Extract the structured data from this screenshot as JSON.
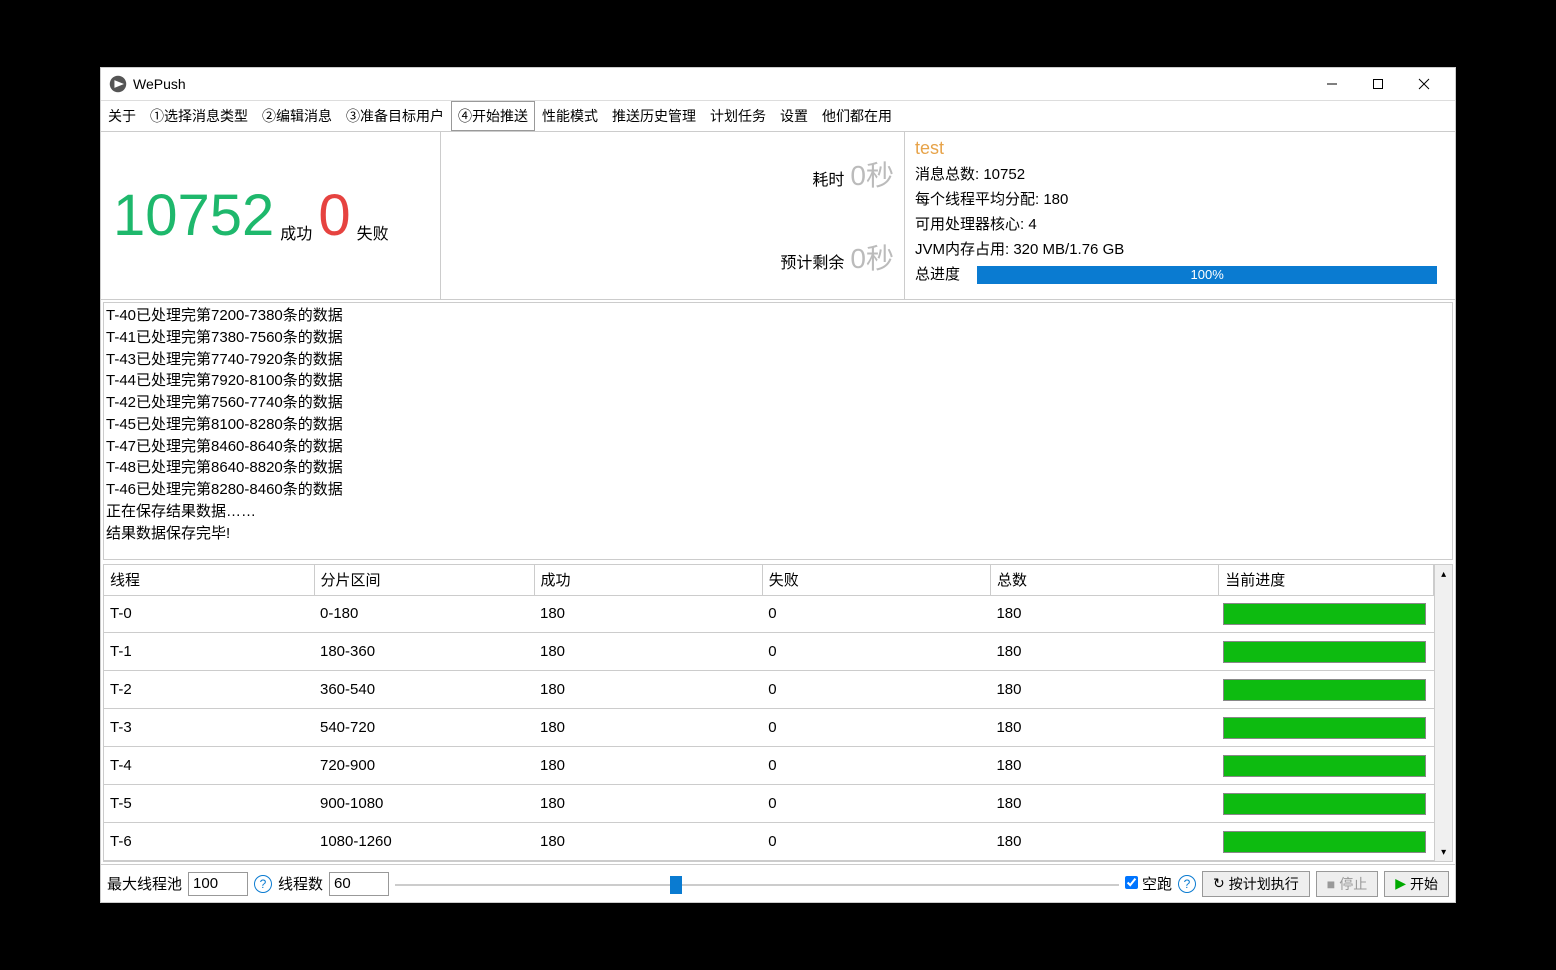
{
  "window": {
    "title": "WePush"
  },
  "tabs": {
    "items": [
      "关于",
      "①选择消息类型",
      "②编辑消息",
      "③准备目标用户",
      "④开始推送",
      "性能模式",
      "推送历史管理",
      "计划任务",
      "设置",
      "他们都在用"
    ],
    "active_index": 4
  },
  "stats": {
    "success_count": "10752",
    "success_label": "成功",
    "fail_count": "0",
    "fail_label": "失败",
    "elapsed_label": "耗时",
    "elapsed_value": "0秒",
    "eta_label": "预计剩余",
    "eta_value": "0秒"
  },
  "info": {
    "test_name": "test",
    "total_msg_label": "消息总数:",
    "total_msg_value": "10752",
    "avg_alloc_label": "每个线程平均分配:",
    "avg_alloc_value": "180",
    "cpu_cores_label": "可用处理器核心:",
    "cpu_cores_value": "4",
    "jvm_label": "JVM内存占用:",
    "jvm_value": "320 MB/1.76 GB",
    "progress_label": "总进度",
    "progress_value": "100%"
  },
  "log_lines": [
    "T-40已处理完第7200-7380条的数据",
    "T-41已处理完第7380-7560条的数据",
    "T-43已处理完第7740-7920条的数据",
    "T-44已处理完第7920-8100条的数据",
    "T-42已处理完第7560-7740条的数据",
    "T-45已处理完第8100-8280条的数据",
    "T-47已处理完第8460-8640条的数据",
    "T-48已处理完第8640-8820条的数据",
    "T-46已处理完第8280-8460条的数据",
    "正在保存结果数据……",
    "结果数据保存完毕!"
  ],
  "table": {
    "headers": [
      "线程",
      "分片区间",
      "成功",
      "失败",
      "总数",
      "当前进度"
    ],
    "rows": [
      {
        "thread": "T-0",
        "range": "0-180",
        "ok": "180",
        "fail": "0",
        "total": "180"
      },
      {
        "thread": "T-1",
        "range": "180-360",
        "ok": "180",
        "fail": "0",
        "total": "180"
      },
      {
        "thread": "T-2",
        "range": "360-540",
        "ok": "180",
        "fail": "0",
        "total": "180"
      },
      {
        "thread": "T-3",
        "range": "540-720",
        "ok": "180",
        "fail": "0",
        "total": "180"
      },
      {
        "thread": "T-4",
        "range": "720-900",
        "ok": "180",
        "fail": "0",
        "total": "180"
      },
      {
        "thread": "T-5",
        "range": "900-1080",
        "ok": "180",
        "fail": "0",
        "total": "180"
      },
      {
        "thread": "T-6",
        "range": "1080-1260",
        "ok": "180",
        "fail": "0",
        "total": "180"
      }
    ]
  },
  "bottom": {
    "max_pool_label": "最大线程池",
    "max_pool_value": "100",
    "thread_count_label": "线程数",
    "thread_count_value": "60",
    "dry_run_label": "空跑",
    "help_char": "?",
    "schedule_btn": "按计划执行",
    "stop_btn": "停止",
    "start_btn": "开始",
    "refresh_icon": "↻",
    "stop_icon": "■",
    "play_icon": "▶"
  }
}
